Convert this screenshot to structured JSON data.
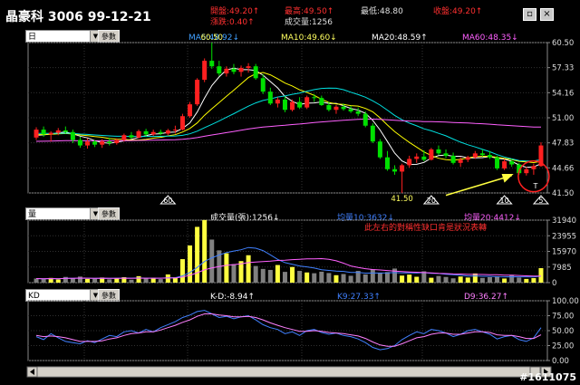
{
  "header": {
    "title": "晶豪科 3006 99-12-21",
    "open_label": "開盤:49.20↑",
    "high_label": "最高:49.50↑",
    "low_label": "最低:48.80",
    "close_label": "收盤:49.20↑",
    "change_label": "漲跌:0.40↑",
    "volume_label": "成交量:1256"
  },
  "controls": {
    "period_combo": "日",
    "volume_combo": "量",
    "kd_combo": "KD",
    "param_button": "參數"
  },
  "colors": {
    "up": "#ff2020",
    "down": "#00e000",
    "ma5": "#ffffff",
    "ma10": "#ffff00",
    "ma20": "#00e0e0",
    "ma60": "#ff60ff",
    "k": "#4080ff",
    "d": "#ff80ff",
    "vol_hi": "#ffff40",
    "vol_lo": "#808080"
  },
  "chart_data": [
    {
      "type": "candlestick",
      "legend": [
        {
          "name": "MA5:48.92↓",
          "color": "#40a0ff"
        },
        {
          "name": "MA10:49.60↓",
          "color": "#ffff60"
        },
        {
          "name": "MA20:48.59↑",
          "color": "#ffffff"
        },
        {
          "name": "MA60:48.35↓",
          "color": "#ff60ff"
        }
      ],
      "y_ticks": [
        "60.50",
        "57.33",
        "54.16",
        "51.00",
        "47.83",
        "44.66",
        "41.50"
      ],
      "ylim": [
        41.5,
        60.5
      ],
      "annotations": [
        {
          "text": "60.50",
          "at_index": 24
        },
        {
          "text": "41.50",
          "at_index": 50
        },
        {
          "text": "60",
          "marker": "triangle",
          "at_index": 18
        },
        {
          "text": "20",
          "marker": "triangle",
          "at_index": 54
        },
        {
          "text": "10",
          "marker": "triangle",
          "at_index": 64
        },
        {
          "text": "5",
          "marker": "triangle",
          "at_index": 69
        },
        {
          "text": "T",
          "at_index": 68
        }
      ],
      "candles": [
        [
          48.5,
          49.8,
          48.2,
          49.5
        ],
        [
          49.5,
          49.9,
          48.6,
          48.9
        ],
        [
          48.9,
          49.3,
          48.0,
          49.1
        ],
        [
          49.1,
          49.7,
          48.8,
          49.4
        ],
        [
          49.4,
          49.9,
          49.0,
          49.2
        ],
        [
          49.2,
          49.5,
          47.8,
          48.2
        ],
        [
          48.2,
          48.6,
          47.2,
          47.5
        ],
        [
          47.5,
          48.4,
          47.1,
          48.0
        ],
        [
          48.0,
          48.2,
          47.3,
          47.6
        ],
        [
          47.6,
          48.3,
          47.2,
          48.0
        ],
        [
          48.0,
          48.5,
          47.5,
          47.8
        ],
        [
          47.8,
          48.4,
          47.6,
          48.2
        ],
        [
          48.2,
          49.0,
          48.0,
          48.8
        ],
        [
          48.8,
          49.2,
          48.3,
          48.5
        ],
        [
          48.5,
          49.5,
          48.4,
          49.3
        ],
        [
          49.3,
          49.6,
          48.6,
          48.9
        ],
        [
          48.9,
          49.5,
          48.7,
          49.2
        ],
        [
          49.2,
          49.5,
          48.8,
          49.0
        ],
        [
          49.0,
          49.6,
          48.8,
          49.4
        ],
        [
          49.4,
          50.0,
          49.0,
          49.5
        ],
        [
          49.5,
          51.5,
          49.4,
          51.2
        ],
        [
          51.2,
          53.0,
          51.0,
          52.7
        ],
        [
          52.7,
          56.0,
          52.5,
          55.8
        ],
        [
          55.8,
          58.5,
          55.5,
          58.2
        ],
        [
          58.2,
          60.5,
          57.2,
          57.5
        ],
        [
          57.5,
          58.2,
          56.3,
          56.6
        ],
        [
          56.6,
          57.5,
          56.2,
          57.2
        ],
        [
          57.2,
          57.8,
          56.5,
          56.8
        ],
        [
          56.8,
          57.6,
          56.2,
          57.3
        ],
        [
          57.3,
          57.9,
          56.7,
          57.5
        ],
        [
          57.5,
          57.8,
          55.8,
          56.0
        ],
        [
          56.0,
          56.5,
          54.0,
          54.3
        ],
        [
          54.3,
          54.8,
          52.6,
          52.8
        ],
        [
          52.8,
          53.6,
          52.3,
          53.3
        ],
        [
          53.3,
          53.7,
          51.7,
          52.0
        ],
        [
          52.0,
          53.3,
          51.8,
          53.0
        ],
        [
          53.0,
          53.6,
          52.1,
          52.3
        ],
        [
          52.3,
          53.8,
          52.1,
          53.6
        ],
        [
          53.6,
          54.0,
          53.0,
          53.5
        ],
        [
          53.5,
          53.8,
          52.5,
          52.6
        ],
        [
          52.6,
          53.0,
          51.8,
          52.0
        ],
        [
          52.0,
          52.6,
          51.5,
          52.4
        ],
        [
          52.4,
          52.8,
          51.9,
          52.1
        ],
        [
          52.1,
          52.5,
          51.6,
          51.8
        ],
        [
          51.8,
          52.3,
          51.2,
          51.5
        ],
        [
          51.5,
          51.8,
          49.8,
          50.0
        ],
        [
          50.0,
          50.3,
          47.8,
          48.0
        ],
        [
          48.0,
          48.3,
          45.8,
          46.0
        ],
        [
          46.0,
          46.8,
          44.3,
          44.5
        ],
        [
          44.5,
          45.0,
          43.8,
          44.2
        ],
        [
          44.2,
          45.2,
          41.5,
          45.0
        ],
        [
          45.0,
          46.2,
          44.7,
          45.8
        ],
        [
          45.8,
          46.5,
          45.3,
          46.1
        ],
        [
          46.1,
          46.9,
          45.5,
          45.7
        ],
        [
          45.7,
          47.2,
          45.6,
          47.0
        ],
        [
          47.0,
          47.5,
          46.3,
          46.5
        ],
        [
          46.5,
          47.0,
          45.9,
          46.2
        ],
        [
          46.2,
          46.6,
          45.1,
          45.3
        ],
        [
          45.3,
          46.0,
          44.8,
          45.7
        ],
        [
          45.7,
          46.2,
          45.4,
          46.0
        ],
        [
          46.0,
          46.8,
          45.8,
          46.5
        ],
        [
          46.5,
          47.0,
          46.1,
          46.3
        ],
        [
          46.3,
          46.8,
          45.8,
          46.0
        ],
        [
          46.0,
          46.2,
          44.4,
          44.6
        ],
        [
          44.6,
          45.8,
          44.4,
          45.5
        ],
        [
          45.5,
          45.8,
          44.8,
          45.1
        ],
        [
          45.1,
          45.3,
          43.8,
          44.0
        ],
        [
          44.0,
          44.8,
          43.7,
          44.5
        ],
        [
          44.5,
          45.2,
          43.8,
          44.9
        ],
        [
          44.9,
          47.9,
          44.8,
          47.5
        ]
      ]
    },
    {
      "type": "bar",
      "title": "成交量(張):1256↓",
      "legend": [
        {
          "name": "均量10:3632↓",
          "color": "#4080ff"
        },
        {
          "name": "均量20:4412↓",
          "color": "#ff60ff"
        }
      ],
      "annotation": "此左右的對稱性缺口肯是狀況表轉",
      "y_ticks": [
        "31940",
        "23955",
        "15970",
        "7985",
        "0"
      ],
      "ylim": [
        0,
        31940
      ],
      "values": [
        2100,
        1800,
        2400,
        1600,
        2900,
        2200,
        3100,
        1900,
        2000,
        2600,
        1700,
        2300,
        2800,
        1500,
        3300,
        2100,
        2500,
        1800,
        4200,
        2700,
        12000,
        19000,
        28500,
        32000,
        22000,
        16500,
        15000,
        9500,
        11000,
        14000,
        8500,
        7000,
        6500,
        9000,
        5500,
        8000,
        6000,
        5200,
        4800,
        5600,
        4900,
        3800,
        4400,
        3500,
        6000,
        4200,
        6800,
        5100,
        5400,
        7200,
        3600,
        4100,
        3000,
        5800,
        2500,
        3400,
        2900,
        2200,
        3100,
        2600,
        4700,
        2400,
        2800,
        3300,
        2100,
        4000,
        2600,
        1900,
        2300,
        7400
      ]
    },
    {
      "type": "line",
      "title": "K-D:-8.94↑",
      "series": [
        {
          "name": "K9:27.33↑",
          "values": [
            40,
            35,
            45,
            38,
            32,
            30,
            28,
            33,
            30,
            36,
            42,
            40,
            48,
            50,
            46,
            52,
            48,
            55,
            60,
            65,
            72,
            76,
            82,
            84,
            78,
            72,
            74,
            70,
            73,
            75,
            68,
            60,
            55,
            52,
            45,
            48,
            42,
            50,
            52,
            47,
            44,
            46,
            42,
            40,
            36,
            30,
            22,
            18,
            20,
            25,
            35,
            42,
            48,
            45,
            52,
            50,
            46,
            40,
            44,
            50,
            52,
            48,
            44,
            36,
            40,
            42,
            35,
            32,
            38,
            55
          ]
        },
        {
          "name": "D9:36.27↑",
          "values": [
            42,
            40,
            41,
            40,
            38,
            35,
            32,
            32,
            32,
            33,
            36,
            38,
            42,
            45,
            46,
            48,
            48,
            51,
            55,
            59,
            64,
            68,
            74,
            78,
            78,
            76,
            75,
            73,
            73,
            74,
            72,
            68,
            63,
            59,
            55,
            52,
            49,
            49,
            50,
            49,
            47,
            46,
            45,
            43,
            41,
            37,
            31,
            26,
            24,
            24,
            28,
            33,
            38,
            40,
            44,
            46,
            46,
            44,
            44,
            46,
            48,
            48,
            47,
            43,
            42,
            42,
            40,
            37,
            37,
            43
          ]
        }
      ],
      "y_ticks": [
        "100.00",
        "75.00",
        "50.00",
        "25.00",
        "0.00"
      ],
      "ylim": [
        0,
        100
      ]
    }
  ],
  "watermark": "#1611075"
}
